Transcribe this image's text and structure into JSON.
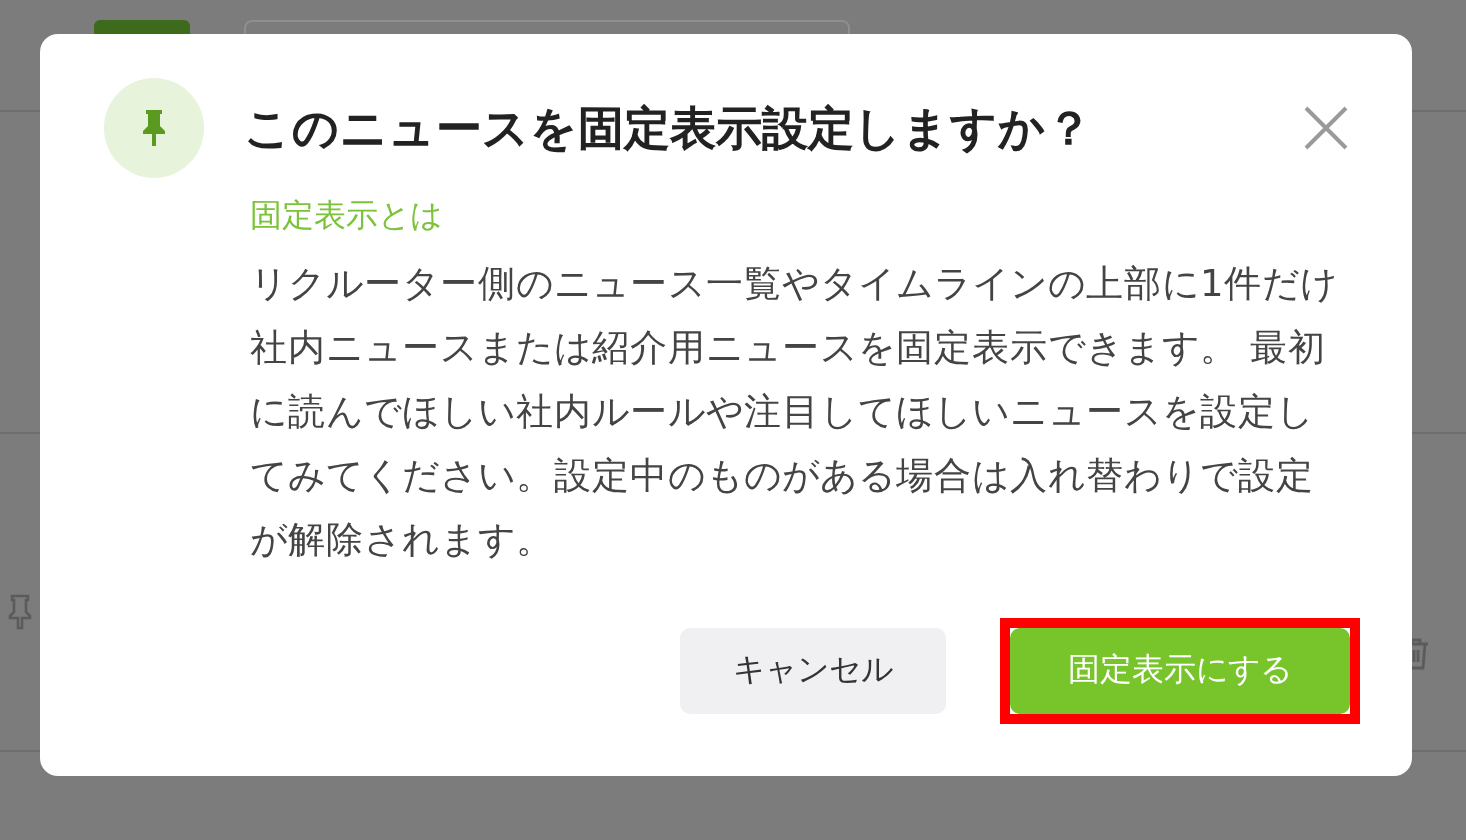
{
  "dialog": {
    "title": "このニュースを固定表示設定しますか？",
    "section_heading": "固定表示とは",
    "description": "リクルーター側のニュース一覧やタイムラインの上部に1件だけ社内ニュースまたは紹介用ニュースを固定表示できます。 最初に読んでほしい社内ルールや注目してほしいニュースを設定してみてください。設定中のものがある場合は入れ替わりで設定が解除されます。",
    "buttons": [
      {
        "label": "キャンセル",
        "kind": "secondary",
        "highlighted": false
      },
      {
        "label": "固定表示にする",
        "kind": "primary",
        "highlighted": true
      }
    ]
  }
}
